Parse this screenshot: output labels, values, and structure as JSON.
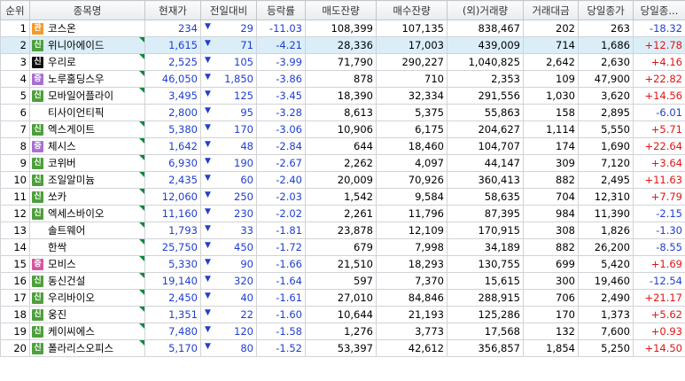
{
  "headers": [
    "순위",
    "종목명",
    "현재가",
    "전일대비",
    "등락률",
    "매도잔량",
    "매수잔량",
    "(외)거래량",
    "거래대금",
    "당일종가",
    "당일종..."
  ],
  "rows": [
    {
      "rank": "1",
      "badge": "관",
      "badge_color": "orange",
      "name": "코스온",
      "price": "234",
      "change": "29",
      "rate": "-11.03",
      "ask": "108,399",
      "bid": "107,135",
      "volume": "838,467",
      "amount": "202",
      "close": "263",
      "closerate": "-18.32",
      "flag": false
    },
    {
      "rank": "2",
      "badge": "신",
      "badge_color": "green",
      "name": "위니아에이드",
      "price": "1,615",
      "change": "71",
      "rate": "-4.21",
      "ask": "28,336",
      "bid": "17,003",
      "volume": "439,009",
      "amount": "714",
      "close": "1,686",
      "closerate": "+12.78",
      "flag": true,
      "selected": true
    },
    {
      "rank": "3",
      "badge": "신",
      "badge_color": "black",
      "name": "우리로",
      "price": "2,525",
      "change": "105",
      "rate": "-3.99",
      "ask": "71,790",
      "bid": "290,227",
      "volume": "1,040,825",
      "amount": "2,642",
      "close": "2,630",
      "closerate": "+4.16",
      "flag": true
    },
    {
      "rank": "4",
      "badge": "증",
      "badge_color": "purple",
      "name": "노루홀딩스우",
      "price": "46,050",
      "change": "1,850",
      "rate": "-3.86",
      "ask": "878",
      "bid": "710",
      "volume": "2,353",
      "amount": "109",
      "close": "47,900",
      "closerate": "+22.82",
      "flag": true
    },
    {
      "rank": "5",
      "badge": "신",
      "badge_color": "green",
      "name": "모바일어플라이",
      "price": "3,495",
      "change": "125",
      "rate": "-3.45",
      "ask": "18,390",
      "bid": "32,334",
      "volume": "291,556",
      "amount": "1,030",
      "close": "3,620",
      "closerate": "+14.56",
      "flag": true
    },
    {
      "rank": "6",
      "badge": "",
      "badge_color": "",
      "name": "티사이언티픽",
      "price": "2,800",
      "change": "95",
      "rate": "-3.28",
      "ask": "8,613",
      "bid": "5,375",
      "volume": "55,863",
      "amount": "158",
      "close": "2,895",
      "closerate": "-6.01",
      "flag": false
    },
    {
      "rank": "7",
      "badge": "신",
      "badge_color": "green",
      "name": "엑스게이트",
      "price": "5,380",
      "change": "170",
      "rate": "-3.06",
      "ask": "10,906",
      "bid": "6,175",
      "volume": "204,627",
      "amount": "1,114",
      "close": "5,550",
      "closerate": "+5.71",
      "flag": true
    },
    {
      "rank": "8",
      "badge": "증",
      "badge_color": "purple",
      "name": "체시스",
      "price": "1,642",
      "change": "48",
      "rate": "-2.84",
      "ask": "644",
      "bid": "18,460",
      "volume": "104,707",
      "amount": "174",
      "close": "1,690",
      "closerate": "+22.64",
      "flag": true
    },
    {
      "rank": "9",
      "badge": "신",
      "badge_color": "green",
      "name": "코위버",
      "price": "6,930",
      "change": "190",
      "rate": "-2.67",
      "ask": "2,262",
      "bid": "4,097",
      "volume": "44,147",
      "amount": "309",
      "close": "7,120",
      "closerate": "+3.64",
      "flag": true
    },
    {
      "rank": "10",
      "badge": "신",
      "badge_color": "green",
      "name": "조일알미늄",
      "price": "2,435",
      "change": "60",
      "rate": "-2.40",
      "ask": "20,009",
      "bid": "70,926",
      "volume": "360,413",
      "amount": "882",
      "close": "2,495",
      "closerate": "+11.63",
      "flag": true
    },
    {
      "rank": "11",
      "badge": "신",
      "badge_color": "green",
      "name": "쏘카",
      "price": "12,060",
      "change": "250",
      "rate": "-2.03",
      "ask": "1,542",
      "bid": "9,584",
      "volume": "58,635",
      "amount": "704",
      "close": "12,310",
      "closerate": "+7.79",
      "flag": true
    },
    {
      "rank": "12",
      "badge": "신",
      "badge_color": "green",
      "name": "엑세스바이오",
      "price": "11,160",
      "change": "230",
      "rate": "-2.02",
      "ask": "2,261",
      "bid": "11,796",
      "volume": "87,395",
      "amount": "984",
      "close": "11,390",
      "closerate": "-2.15",
      "flag": true
    },
    {
      "rank": "13",
      "badge": "",
      "badge_color": "",
      "name": "솔트웨어",
      "price": "1,793",
      "change": "33",
      "rate": "-1.81",
      "ask": "23,878",
      "bid": "12,109",
      "volume": "170,915",
      "amount": "308",
      "close": "1,826",
      "closerate": "-1.30",
      "flag": true
    },
    {
      "rank": "14",
      "badge": "",
      "badge_color": "",
      "name": "한싹",
      "price": "25,750",
      "change": "450",
      "rate": "-1.72",
      "ask": "679",
      "bid": "7,998",
      "volume": "34,189",
      "amount": "882",
      "close": "26,200",
      "closerate": "-8.55",
      "flag": true
    },
    {
      "rank": "15",
      "badge": "증",
      "badge_color": "pink",
      "name": "모비스",
      "price": "5,330",
      "change": "90",
      "rate": "-1.66",
      "ask": "21,510",
      "bid": "18,293",
      "volume": "130,755",
      "amount": "699",
      "close": "5,420",
      "closerate": "+1.69",
      "flag": true
    },
    {
      "rank": "16",
      "badge": "신",
      "badge_color": "green",
      "name": "동신건설",
      "price": "19,140",
      "change": "320",
      "rate": "-1.64",
      "ask": "597",
      "bid": "7,370",
      "volume": "15,615",
      "amount": "300",
      "close": "19,460",
      "closerate": "-12.54",
      "flag": true
    },
    {
      "rank": "17",
      "badge": "신",
      "badge_color": "green",
      "name": "우리바이오",
      "price": "2,450",
      "change": "40",
      "rate": "-1.61",
      "ask": "27,010",
      "bid": "84,846",
      "volume": "288,915",
      "amount": "706",
      "close": "2,490",
      "closerate": "+21.17",
      "flag": true
    },
    {
      "rank": "18",
      "badge": "신",
      "badge_color": "green",
      "name": "웅진",
      "price": "1,351",
      "change": "22",
      "rate": "-1.60",
      "ask": "10,644",
      "bid": "21,193",
      "volume": "125,286",
      "amount": "170",
      "close": "1,373",
      "closerate": "+5.62",
      "flag": true
    },
    {
      "rank": "19",
      "badge": "신",
      "badge_color": "green",
      "name": "케이씨에스",
      "price": "7,480",
      "change": "120",
      "rate": "-1.58",
      "ask": "1,276",
      "bid": "3,773",
      "volume": "17,568",
      "amount": "132",
      "close": "7,600",
      "closerate": "+0.93",
      "flag": true
    },
    {
      "rank": "20",
      "badge": "신",
      "badge_color": "green",
      "name": "폴라리스오피스",
      "price": "5,170",
      "change": "80",
      "rate": "-1.52",
      "ask": "53,397",
      "bid": "42,612",
      "volume": "356,857",
      "amount": "1,854",
      "close": "5,250",
      "closerate": "+14.50",
      "flag": true
    }
  ],
  "icons": {
    "down_arrow": "down-triangle-icon",
    "flag": "corner-flag-icon"
  },
  "colors": {
    "down": "#1f3fcf",
    "up": "#e01515",
    "badge_orange": "#f39a2b",
    "badge_green": "#4e9f3d",
    "badge_purple": "#a86fd1",
    "badge_black": "#111111",
    "badge_pink": "#d955a0",
    "selected_row": "#dbeef8"
  }
}
